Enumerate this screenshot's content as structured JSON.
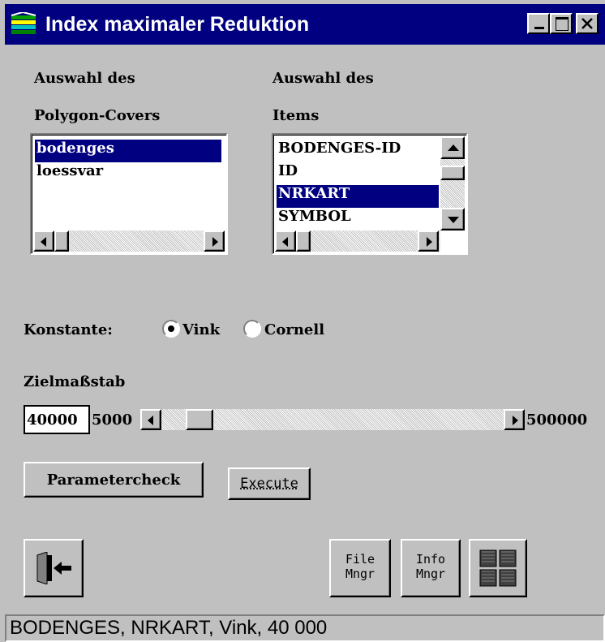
{
  "window": {
    "title": "Index maximaler Reduktion",
    "icon": "app-icon"
  },
  "polygon_section": {
    "label_line1": "Auswahl des",
    "label_line2": "Polygon-Covers",
    "items": [
      "bodenges",
      "loessvar"
    ],
    "selected": "bodenges"
  },
  "items_section": {
    "label_line1": "Auswahl des",
    "label_line2": "Items",
    "items": [
      "BODENGES-ID",
      "ID",
      "NRKART",
      "SYMBOL"
    ],
    "selected": "NRKART"
  },
  "constant": {
    "label": "Konstante:",
    "options": [
      "Vink",
      "Cornell"
    ],
    "selected": "Vink"
  },
  "scale": {
    "label": "Zielmaßstab",
    "value": "40000",
    "min_label": "5000",
    "max_label": "500000",
    "slider_fraction": 0.04
  },
  "buttons": {
    "parametercheck": "Parametercheck",
    "execute": "Execute",
    "file_mngr_line1": "File",
    "file_mngr_line2": "Mngr",
    "info_mngr_line1": "Info",
    "info_mngr_line2": "Mngr"
  },
  "status": {
    "text": "BODENGES, NRKART, Vink, 40 000"
  },
  "colors": {
    "face": "#c0c0c0",
    "title_bar": "#000080",
    "selection": "#000080"
  }
}
